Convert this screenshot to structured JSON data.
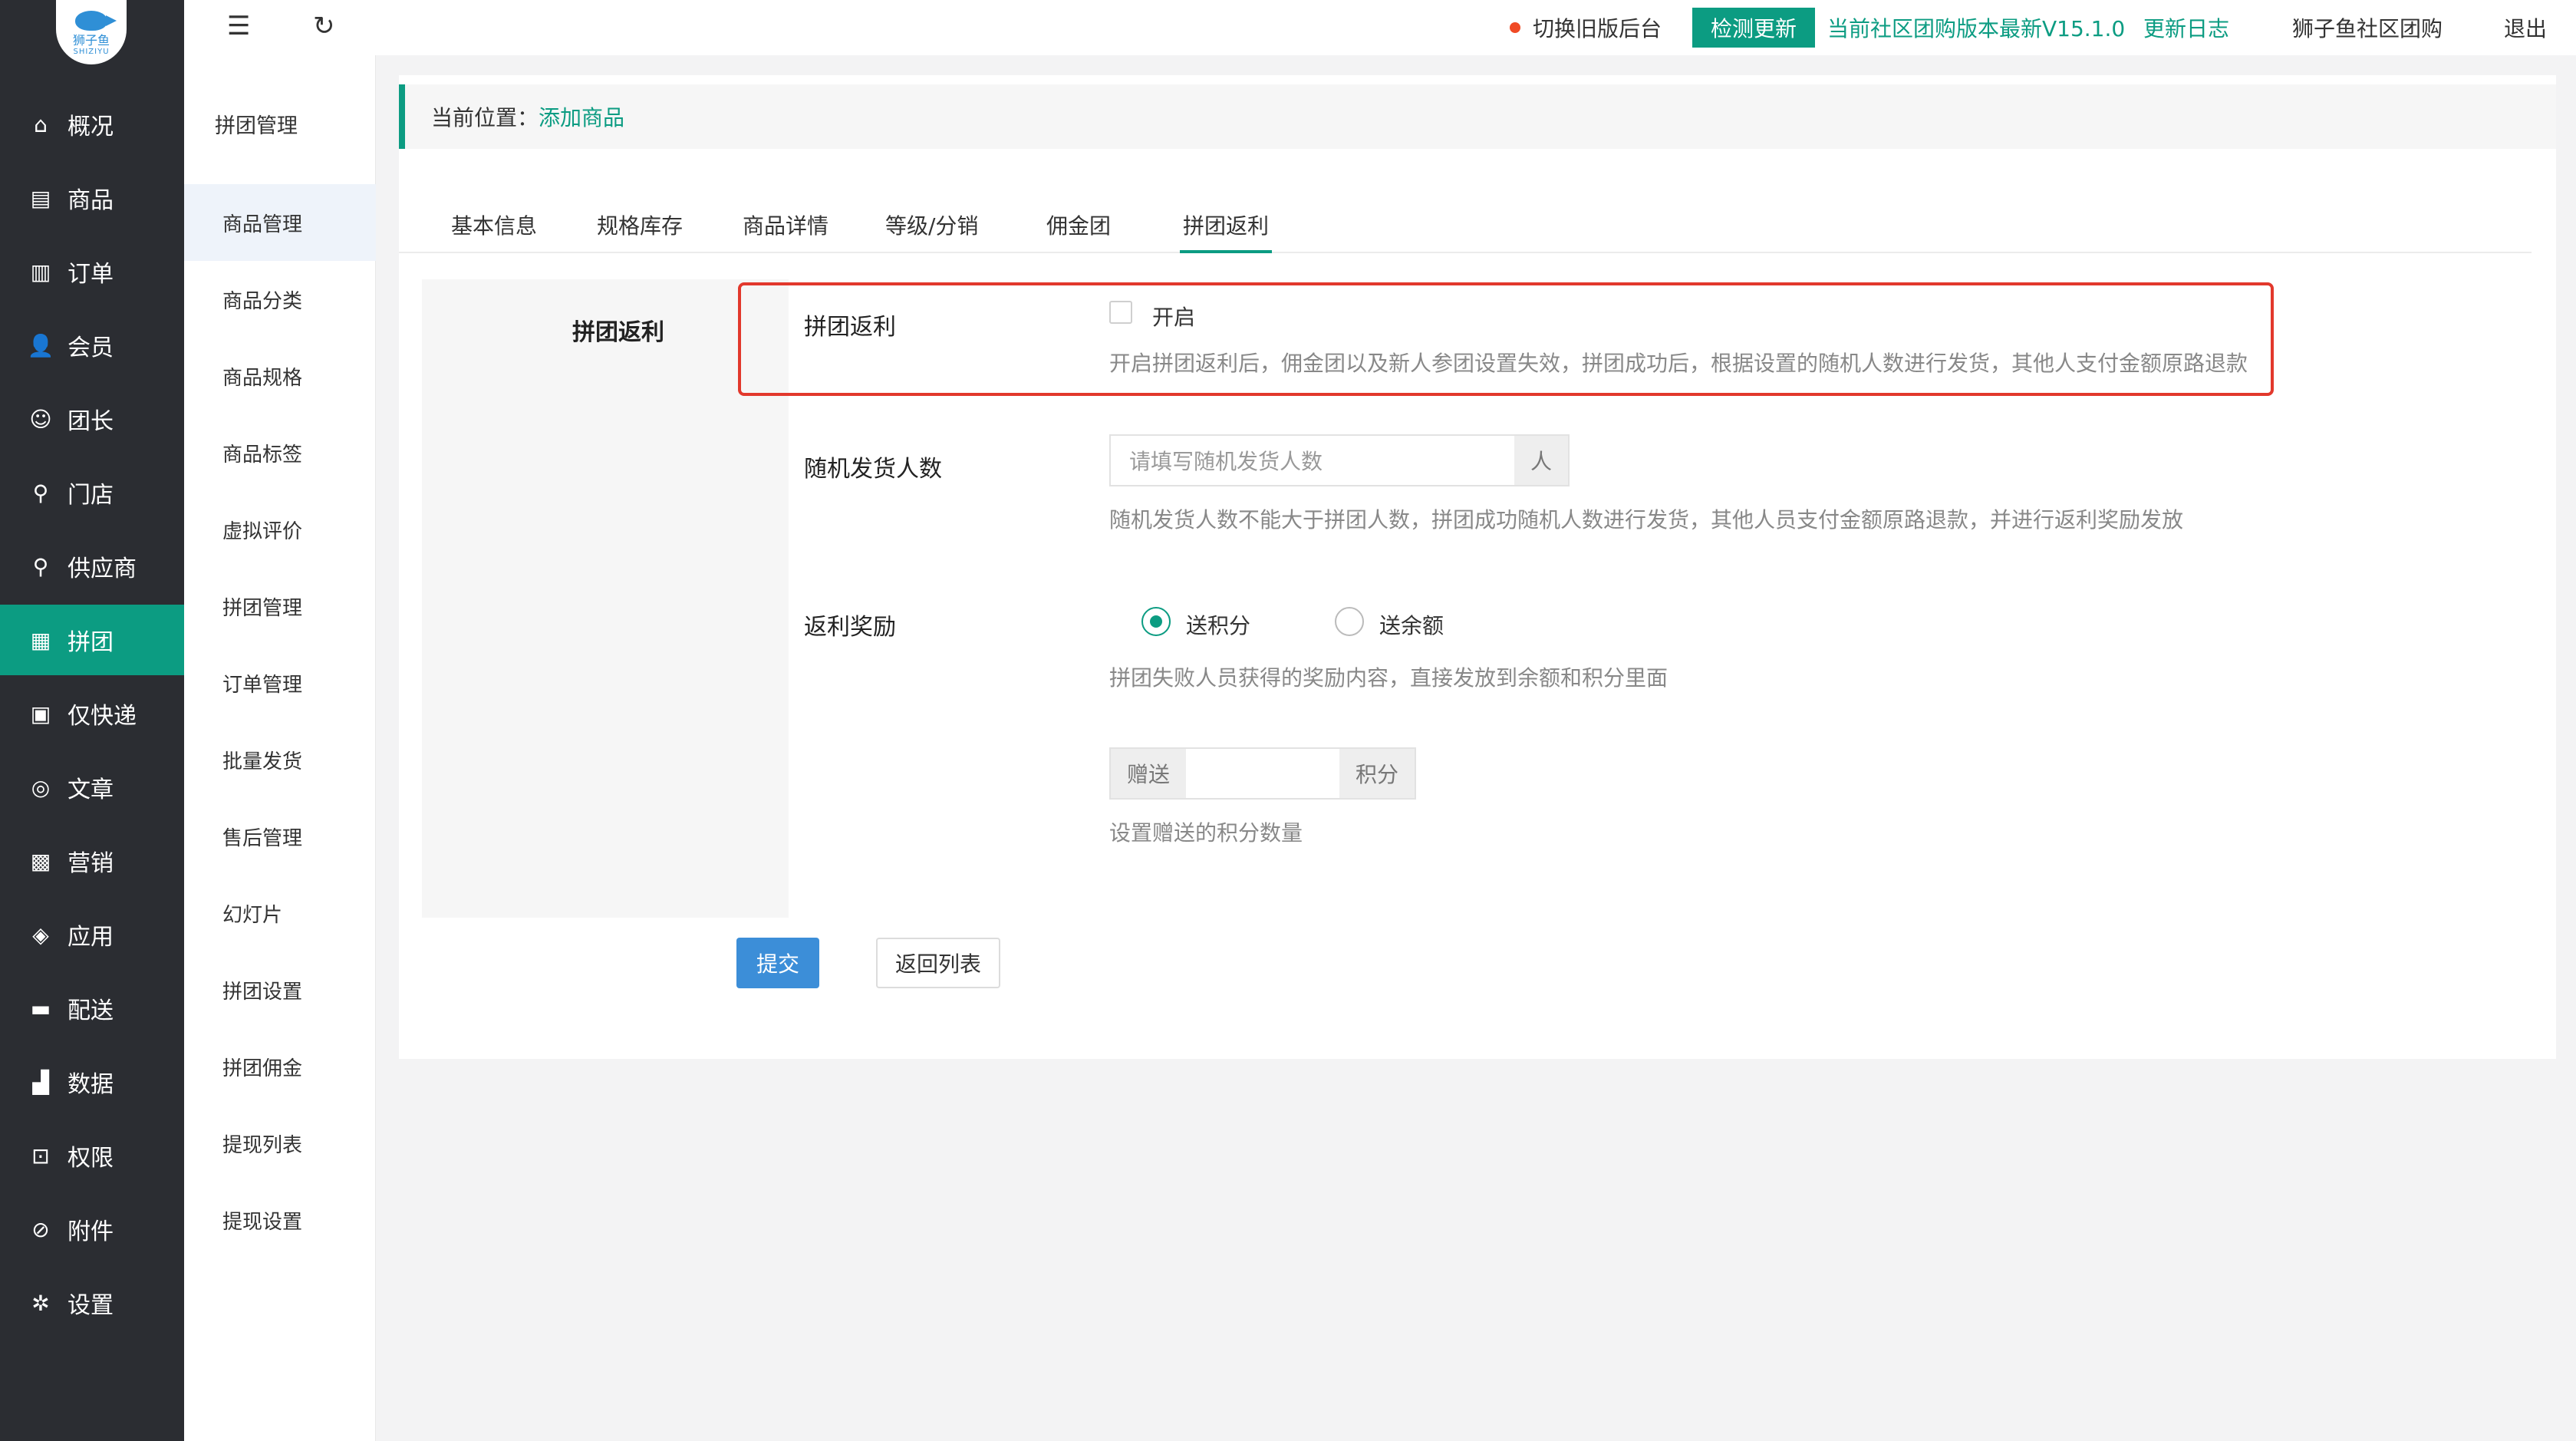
{
  "logo": {
    "text": "狮子鱼",
    "sub": "SHIZIYU"
  },
  "leftnav": {
    "items": [
      {
        "label": "概况",
        "icon": "home-icon",
        "glyph": "⌂"
      },
      {
        "label": "商品",
        "icon": "product-icon",
        "glyph": "▤"
      },
      {
        "label": "订单",
        "icon": "order-icon",
        "glyph": "▥"
      },
      {
        "label": "会员",
        "icon": "member-icon",
        "glyph": "👤"
      },
      {
        "label": "团长",
        "icon": "leader-icon",
        "glyph": "☺"
      },
      {
        "label": "门店",
        "icon": "store-icon",
        "glyph": "⚲"
      },
      {
        "label": "供应商",
        "icon": "supplier-icon",
        "glyph": "⚲"
      },
      {
        "label": "拼团",
        "icon": "group-buy-icon",
        "glyph": "▦"
      },
      {
        "label": "仅快递",
        "icon": "express-icon",
        "glyph": "▣"
      },
      {
        "label": "文章",
        "icon": "article-icon",
        "glyph": "◎"
      },
      {
        "label": "营销",
        "icon": "gift-icon",
        "glyph": "▩"
      },
      {
        "label": "应用",
        "icon": "app-icon",
        "glyph": "◈"
      },
      {
        "label": "配送",
        "icon": "truck-icon",
        "glyph": "▬"
      },
      {
        "label": "数据",
        "icon": "chart-icon",
        "glyph": "▟"
      },
      {
        "label": "权限",
        "icon": "lock-icon",
        "glyph": "⊡"
      },
      {
        "label": "附件",
        "icon": "link-icon",
        "glyph": "⊘"
      },
      {
        "label": "设置",
        "icon": "gear-icon",
        "glyph": "✲"
      }
    ]
  },
  "subnav": {
    "title": "拼团管理",
    "items": [
      {
        "label": "商品管理"
      },
      {
        "label": "商品分类"
      },
      {
        "label": "商品规格"
      },
      {
        "label": "商品标签"
      },
      {
        "label": "虚拟评价"
      },
      {
        "label": "拼团管理"
      },
      {
        "label": "订单管理"
      },
      {
        "label": "批量发货"
      },
      {
        "label": "售后管理"
      },
      {
        "label": "幻灯片"
      },
      {
        "label": "拼团设置"
      },
      {
        "label": "拼团佣金"
      },
      {
        "label": "提现列表"
      },
      {
        "label": "提现设置"
      }
    ]
  },
  "topbar": {
    "menu_glyph": "☰",
    "refresh_glyph": "↻",
    "switch_old": "切换旧版后台",
    "check_update": "检测更新",
    "version_text": "当前社区团购版本最新V15.1.0",
    "changelog": "更新日志",
    "shop_name": "狮子鱼社区团购",
    "logout": "退出"
  },
  "breadcrumb": {
    "prefix": "当前位置：",
    "current": "添加商品"
  },
  "tabs": [
    "基本信息",
    "规格库存",
    "商品详情",
    "等级/分销",
    "佣金团",
    "拼团返利"
  ],
  "form": {
    "section": "拼团返利",
    "rebate": {
      "label": "拼团返利",
      "checkbox_label": "开启",
      "help": "开启拼团返利后，佣金团以及新人参团设置失效，拼团成功后，根据设置的随机人数进行发货，其他人支付金额原路退款"
    },
    "random": {
      "label": "随机发货人数",
      "placeholder": "请填写随机发货人数",
      "unit": "人",
      "help": "随机发货人数不能大于拼团人数，拼团成功随机人数进行发货，其他人员支付金额原路退款，并进行返利奖励发放"
    },
    "reward": {
      "label": "返利奖励",
      "options": [
        "送积分",
        "送余额"
      ],
      "selected": "送积分",
      "help": "拼团失败人员获得的奖励内容，直接发放到余额和积分里面",
      "prefix": "赠送",
      "suffix": "积分",
      "value": "",
      "amount_help": "设置赠送的积分数量"
    }
  },
  "buttons": {
    "submit": "提交",
    "back": "返回列表"
  },
  "colors": {
    "accent": "#0c9c82",
    "nav_bg": "#2b2d32",
    "submit": "#3c8ed8",
    "highlight": "#e2382c"
  }
}
